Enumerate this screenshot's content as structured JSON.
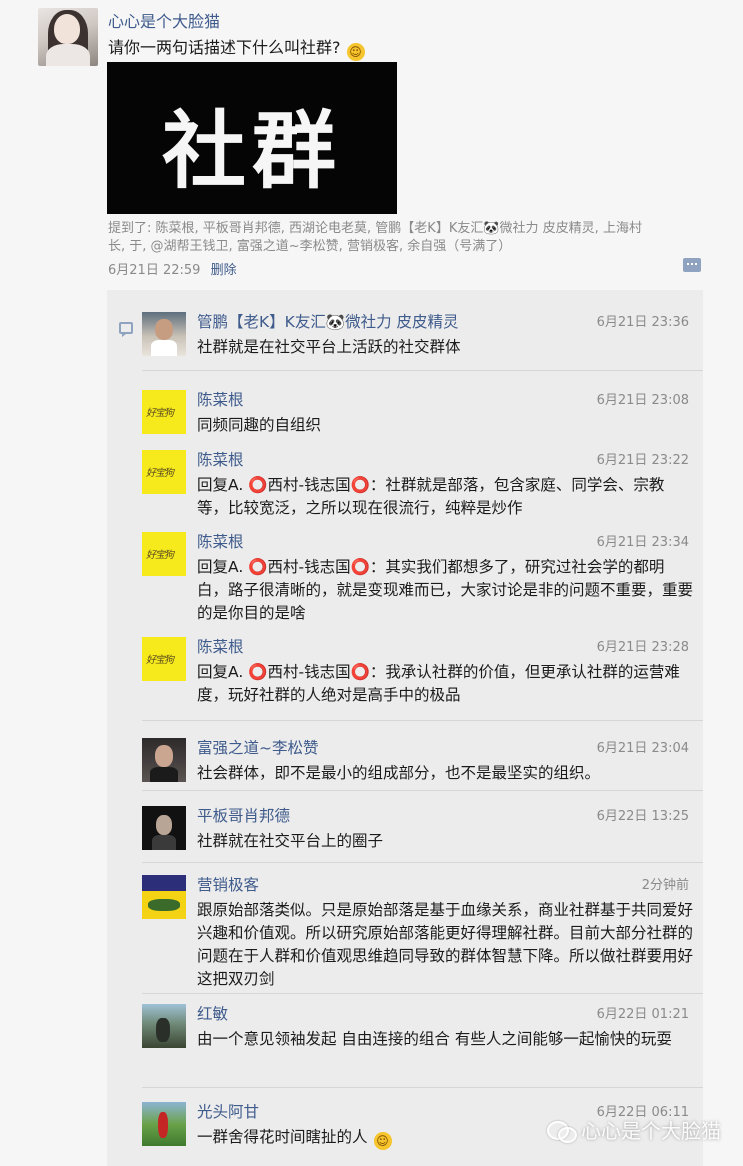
{
  "post": {
    "author": "心心是个大脸猫",
    "text": "请你一两句话描述下什么叫社群?",
    "emoji": "smile-emoji",
    "image_text": "社群",
    "mentions": "提到了: 陈菜根, 平板哥肖邦德, 西湖论电老莫, 管鹏【老K】K友汇🐼微社力 皮皮精灵, 上海村长, 于, @湖帮王钱卫, 富强之道~李松赞, 营销极客, 余自强（号满了）",
    "time": "6月21日 22:59",
    "delete_label": "删除"
  },
  "comments": [
    {
      "name": "管鹏【老K】K友汇🐼微社力 皮皮精灵",
      "time": "6月21日 23:36",
      "text": "社群就是在社交平台上活跃的社交群体"
    },
    {
      "name": "陈菜根",
      "time": "6月21日 23:08",
      "text": "同频同趣的自组织"
    },
    {
      "name": "陈菜根",
      "time": "6月21日 23:22",
      "text": "回复A. ⭕西村-钱志国⭕：社群就是部落，包含家庭、同学会、宗教等，比较宽泛，之所以现在很流行，纯粹是炒作"
    },
    {
      "name": "陈菜根",
      "time": "6月21日 23:34",
      "text": "回复A. ⭕西村-钱志国⭕：其实我们都想多了，研究过社会学的都明白，路子很清晰的，就是变现难而已，大家讨论是非的问题不重要，重要的是你目的是啥"
    },
    {
      "name": "陈菜根",
      "time": "6月21日 23:28",
      "text": "回复A. ⭕西村-钱志国⭕：我承认社群的价值，但更承认社群的运营难度，玩好社群的人绝对是高手中的极品"
    },
    {
      "name": "富强之道~李松赞",
      "time": "6月21日 23:04",
      "text": "社会群体，即不是最小的组成部分，也不是最坚实的组织。"
    },
    {
      "name": "平板哥肖邦德",
      "time": "6月22日 13:25",
      "text": "社群就在社交平台上的圈子"
    },
    {
      "name": "营销极客",
      "time": "2分钟前",
      "text": "跟原始部落类似。只是原始部落是基于血缘关系，商业社群基于共同爱好兴趣和价值观。所以研究原始部落能更好得理解社群。目前大部分社群的问题在于人群和价值观思维趋同导致的群体智慧下降。所以做社群要用好这把双刃剑"
    },
    {
      "name": "红敏",
      "time": "6月22日 01:21",
      "text": "由一个意见领袖发起 自由连接的组合 有些人之间能够一起愉快的玩耍"
    },
    {
      "name": "光头阿甘",
      "time": "6月22日 06:11",
      "text": "一群舍得花时间瞎扯的人"
    }
  ],
  "watermark": "心心是个大脸猫",
  "colors": {
    "name_link": "#3f5b8c",
    "meta_gray": "#8a8a8a",
    "comment_bg": "#ececec"
  }
}
